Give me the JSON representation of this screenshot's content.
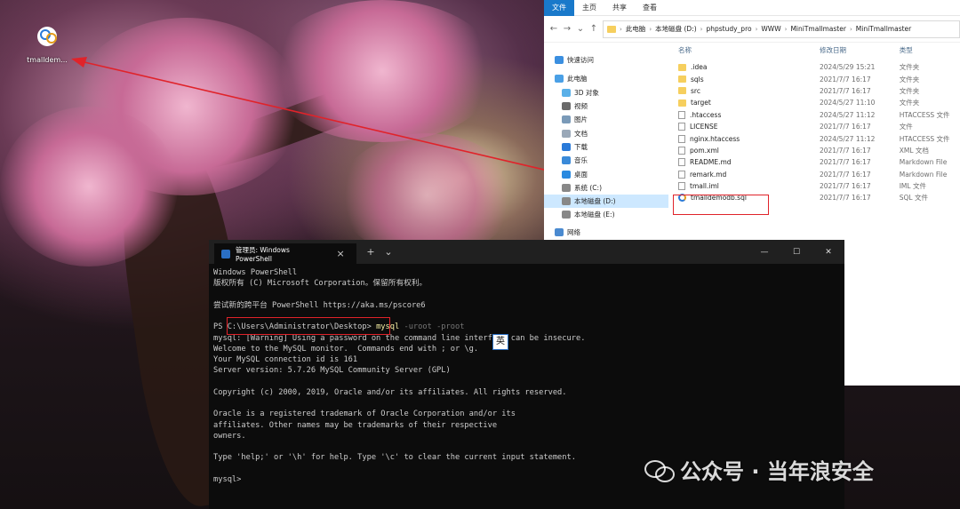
{
  "desktop": {
    "icon_label": "tmalldem..."
  },
  "explorer": {
    "ribbon_tabs": [
      "文件",
      "主页",
      "共享",
      "查看"
    ],
    "breadcrumb": [
      "此电脑",
      "本地磁盘 (D:)",
      "phpstudy_pro",
      "WWW",
      "MiniTmallmaster",
      "MiniTmallmaster"
    ],
    "nav_pane": [
      {
        "label": "快速访问",
        "icon": "star-icon"
      },
      {
        "label": "此电脑",
        "icon": "computer-icon"
      },
      {
        "label": "3D 对象",
        "icon": "cube-icon"
      },
      {
        "label": "视频",
        "icon": "video-icon"
      },
      {
        "label": "图片",
        "icon": "picture-icon"
      },
      {
        "label": "文档",
        "icon": "document-icon"
      },
      {
        "label": "下载",
        "icon": "download-icon"
      },
      {
        "label": "音乐",
        "icon": "music-icon"
      },
      {
        "label": "桌面",
        "icon": "desktop-icon"
      },
      {
        "label": "系统 (C:)",
        "icon": "drive-icon"
      },
      {
        "label": "本地磁盘 (D:)",
        "icon": "drive-icon"
      },
      {
        "label": "本地磁盘 (E:)",
        "icon": "drive-icon"
      },
      {
        "label": "网络",
        "icon": "network-icon"
      }
    ],
    "columns": {
      "name": "名称",
      "date": "修改日期",
      "type": "类型"
    },
    "files": [
      {
        "name": ".idea",
        "date": "2024/5/29 15:21",
        "type": "文件夹",
        "kind": "folder"
      },
      {
        "name": "sqls",
        "date": "2021/7/7 16:17",
        "type": "文件夹",
        "kind": "folder"
      },
      {
        "name": "src",
        "date": "2021/7/7 16:17",
        "type": "文件夹",
        "kind": "folder"
      },
      {
        "name": "target",
        "date": "2024/5/27 11:10",
        "type": "文件夹",
        "kind": "folder"
      },
      {
        "name": ".htaccess",
        "date": "2024/5/27 11:12",
        "type": "HTACCESS 文件",
        "kind": "file"
      },
      {
        "name": "LICENSE",
        "date": "2021/7/7 16:17",
        "type": "文件",
        "kind": "file"
      },
      {
        "name": "nginx.htaccess",
        "date": "2024/5/27 11:12",
        "type": "HTACCESS 文件",
        "kind": "file"
      },
      {
        "name": "pom.xml",
        "date": "2021/7/7 16:17",
        "type": "XML 文档",
        "kind": "file"
      },
      {
        "name": "README.md",
        "date": "2021/7/7 16:17",
        "type": "Markdown File",
        "kind": "file"
      },
      {
        "name": "remark.md",
        "date": "2021/7/7 16:17",
        "type": "Markdown File",
        "kind": "file"
      },
      {
        "name": "tmall.iml",
        "date": "2021/7/7 16:17",
        "type": "IML 文件",
        "kind": "file"
      },
      {
        "name": "tmalldemodb.sql",
        "date": "2021/7/7 16:17",
        "type": "SQL 文件",
        "kind": "sql"
      }
    ]
  },
  "powershell": {
    "tab_title": "管理员: Windows PowerShell",
    "new_tab": "+",
    "dropdown": "⌄",
    "close_tab": "×",
    "window_buttons": [
      "—",
      "☐",
      "✕"
    ],
    "lines": [
      "Windows PowerShell",
      "版权所有 (C) Microsoft Corporation。保留所有权利。",
      "",
      "尝试新的跨平台 PowerShell https://aka.ms/pscore6",
      ""
    ],
    "prompt_prefix": "PS ",
    "prompt_path": "C:\\Users\\Administrator\\Desktop>",
    "command": "mysql",
    "command_args": " -uroot -proot",
    "output_lines": [
      "mysql: [Warning] Using a password on the command line interface can be insecure.",
      "Welcome to the MySQL monitor.  Commands end with ; or \\g.",
      "Your MySQL connection id is 161",
      "Server version: 5.7.26 MySQL Community Server (GPL)",
      "",
      "Copyright (c) 2000, 2019, Oracle and/or its affiliates. All rights reserved.",
      "",
      "Oracle is a registered trademark of Oracle Corporation and/or its",
      "affiliates. Other names may be trademarks of their respective",
      "owners.",
      "",
      "Type 'help;' or '\\h' for help. Type '\\c' to clear the current input statement.",
      "",
      "mysql>"
    ],
    "ime_indicator": "英"
  },
  "watermark": {
    "text": "公众号 · 当年浪安全"
  },
  "colors": {
    "annotation_red": "#e0232a",
    "ribbon_blue": "#1979ca",
    "terminal_bg": "#0c0c0c",
    "command_yellow": "#f9f1a5"
  }
}
